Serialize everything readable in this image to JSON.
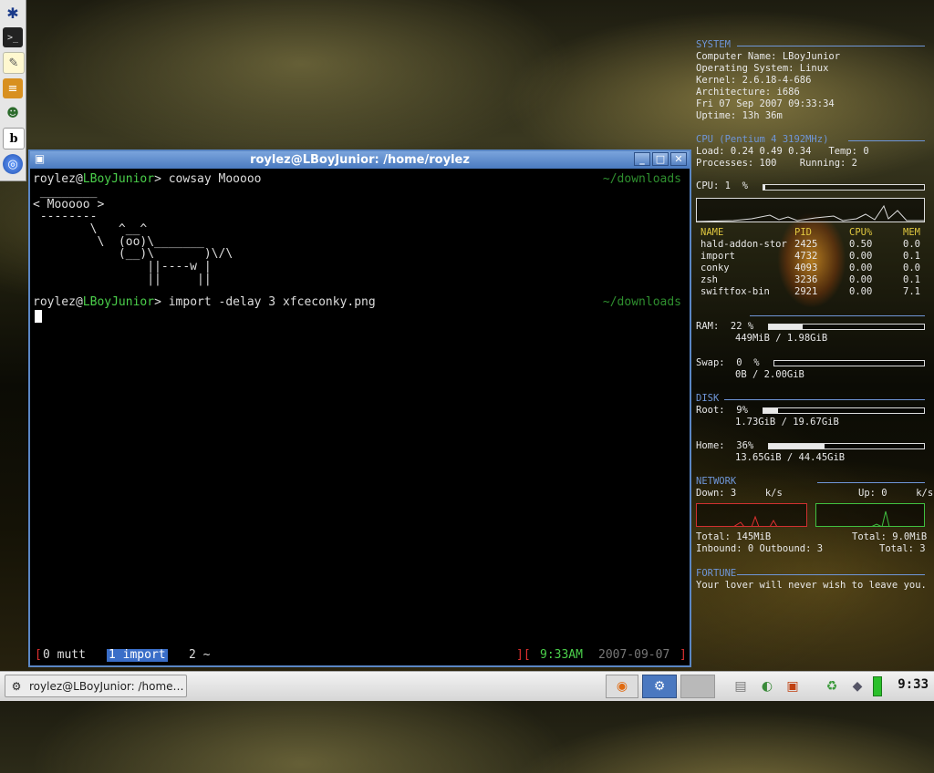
{
  "colors": {
    "window_border": "#5a86c4",
    "conky_header": "#6f96d8",
    "terminal_green": "#4bd04b",
    "tmux_red": "#e03030"
  },
  "launcher": {
    "items": [
      "mouse-icon",
      "terminal-icon",
      "text-editor-icon",
      "notes-icon",
      "users-icon",
      "dictionary-icon",
      "browser-globe-icon"
    ]
  },
  "terminal": {
    "title": "roylez@LBoyJunior: /home/roylez",
    "lines": [
      {
        "user": "roylez@",
        "host": "LBoyJunior",
        "prompt": "> ",
        "cmd": "cowsay Mooooo",
        "dir": "~/downloads"
      },
      {
        "text": " ________"
      },
      {
        "text": "< Mooooo >"
      },
      {
        "text": " --------"
      },
      {
        "text": "        \\   ^__^"
      },
      {
        "text": "         \\  (oo)\\_______"
      },
      {
        "text": "            (__)\\       )\\/\\"
      },
      {
        "text": "                ||----w |"
      },
      {
        "text": "                ||     ||"
      },
      {
        "user": "roylez@",
        "host": "LBoyJunior",
        "prompt": "> ",
        "cmd": "import -delay 3 xfceconky.png",
        "dir": "~/downloads"
      }
    ],
    "tmux": {
      "open": "[",
      "win0": "0 mutt",
      "win1": "1 import",
      "win2": "2 ~",
      "sep": "][",
      "time": "9:33AM",
      "date": "2007-09-07",
      "close": "]"
    }
  },
  "conky": {
    "system_header": "SYSTEM",
    "computer_name": "Computer Name: LBoyJunior",
    "os": "Operating System: Linux",
    "kernel": "Kernel: 2.6.18-4-686",
    "arch": "Architecture: i686",
    "datetime": "Fri 07 Sep 2007 09:33:34",
    "uptime": "Uptime: 13h 36m",
    "cpu_header": "CPU (Pentium 4 3192MHz)",
    "load": "Load: 0.24 0.49 0.34   Temp: 0",
    "processes": "Processes: 100    Running: 2",
    "cpu_usage": "CPU: 1  %",
    "cpu_usage_value": 0.01,
    "proc_cols": [
      "NAME",
      "PID",
      "CPU%",
      "MEM"
    ],
    "procs": [
      [
        "hald-addon-stor",
        "2425",
        "0.50",
        "0.0"
      ],
      [
        "import",
        "4732",
        "0.00",
        "0.1"
      ],
      [
        "conky",
        "4093",
        "0.00",
        "0.0"
      ],
      [
        "zsh",
        "3236",
        "0.00",
        "0.1"
      ],
      [
        "swiftfox-bin",
        "2921",
        "0.00",
        "7.1"
      ]
    ],
    "ram": "RAM:  22 %",
    "ram_value": 0.22,
    "ram_detail": "449MiB / 1.98GiB",
    "swap": "Swap:  0  %",
    "swap_value": 0.0,
    "swap_detail": "0B / 2.00GiB",
    "disk_header": "DISK",
    "root": "Root:  9%",
    "root_value": 0.09,
    "root_detail": "1.73GiB / 19.67GiB",
    "home": "Home:  36%",
    "home_value": 0.36,
    "home_detail": "13.65GiB / 44.45GiB",
    "network_header": "NETWORK",
    "down": "Down: 3     k/s",
    "up": "Up: 0     k/s",
    "total_down": "Total: 145MiB",
    "total_up": "Total: 9.0MiB",
    "inbound": "Inbound: 0 Outbound: 3",
    "total_conn": "Total: 3",
    "fortune_header": "FORTUNE",
    "fortune": "Your lover will never wish to leave you."
  },
  "taskbar": {
    "task_label": "roylez@LBoyJunior: /home…",
    "clock": "9:33"
  }
}
